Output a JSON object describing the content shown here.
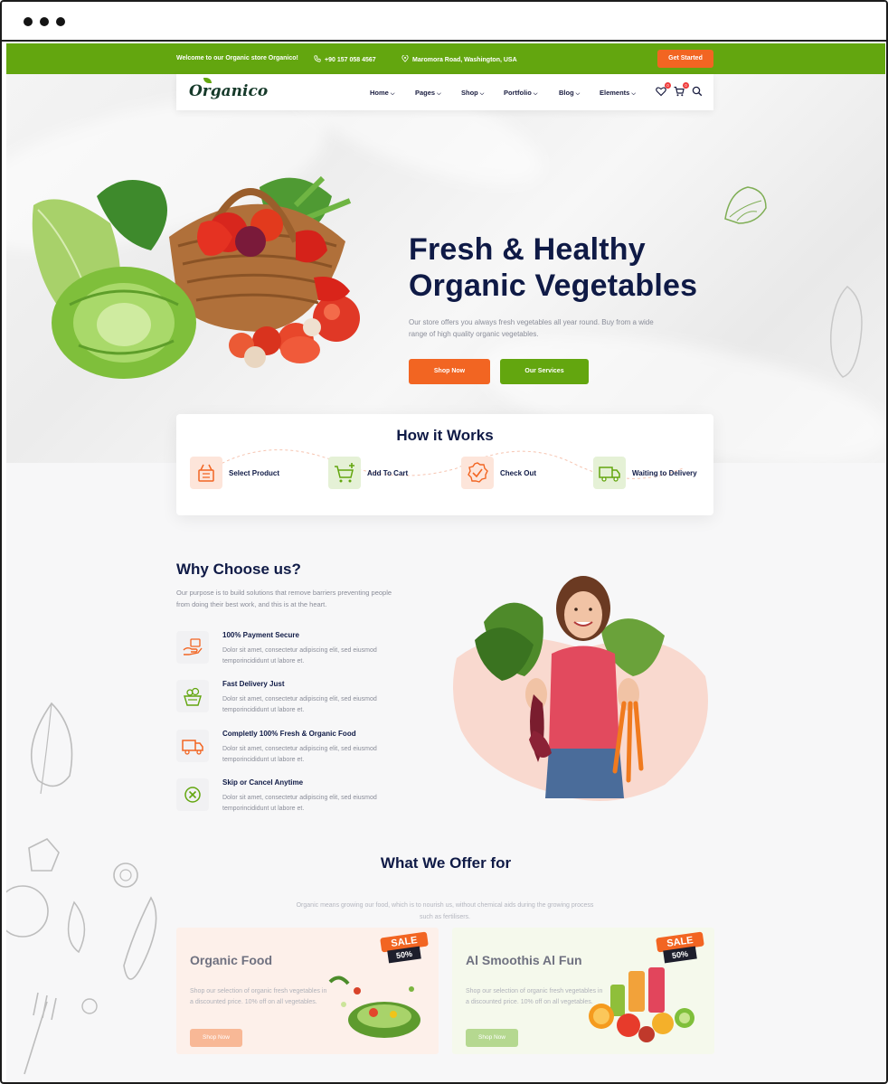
{
  "topbar": {
    "welcome": "Welcome to our Organic store Organico!",
    "phone": "+90 157 058 4567",
    "address": "Maromora Road, Washington, USA",
    "cta": "Get Started"
  },
  "nav": {
    "logo": "Organico",
    "items": [
      "Home",
      "Pages",
      "Shop",
      "Portfolio",
      "Blog",
      "Elements"
    ],
    "wishlist_count": "0",
    "cart_count": "0",
    "icons": [
      "heart-icon",
      "cart-icon",
      "search-icon"
    ]
  },
  "hero": {
    "title_line1": "Fresh & Healthy",
    "title_line2": "Organic Vegetables",
    "description": "Our store offers you always fresh vegetables all year round. Buy from a wide range of high quality organic vegetables.",
    "primary_button": "Shop Now",
    "secondary_button": "Our Services"
  },
  "how": {
    "title": "How  it Works",
    "steps": [
      "Select Product",
      "Add To Cart",
      "Check Out",
      "Waiting to Delivery"
    ]
  },
  "why": {
    "title": "Why Choose us?",
    "description": "Our purpose is to build solutions that remove barriers preventing people from doing their best work, and this is at the heart.",
    "features": [
      {
        "title": "100% Payment Secure",
        "text": "Dolor sit amet, consectetur adipiscing elit, sed eiusmod temporincididunt ut labore et."
      },
      {
        "title": "Fast Delivery Just",
        "text": "Dolor sit amet, consectetur adipiscing elit, sed eiusmod temporincididunt ut labore et."
      },
      {
        "title": "Completly 100% Fresh & Organic Food",
        "text": "Dolor sit amet, consectetur adipiscing elit, sed eiusmod temporincididunt ut labore et."
      },
      {
        "title": "Skip or Cancel Anytime",
        "text": "Dolor sit amet, consectetur adipiscing elit, sed eiusmod temporincididunt ut labore et."
      }
    ]
  },
  "offers": {
    "title": "What We Offer for",
    "description": "Organic means growing our food, which is to nourish us, without chemical aids during the growing process such as fertilisers.",
    "cards": [
      {
        "title": "Organic Food",
        "text": "Shop our selection of organic fresh vegetables in a discounted price. 10% off on all vegetables.",
        "button": "Shop Now",
        "sale": "SALE",
        "percent": "50%"
      },
      {
        "title": "Al Smoothis Al Fun",
        "text": "Shop our selection of organic fresh vegetables in a discounted price. 10% off on all vegetables.",
        "button": "Shop Now",
        "sale": "SALE",
        "percent": "50%"
      }
    ]
  },
  "colors": {
    "green": "#63a60f",
    "orange": "#f26522",
    "navy": "#0f1a46"
  }
}
